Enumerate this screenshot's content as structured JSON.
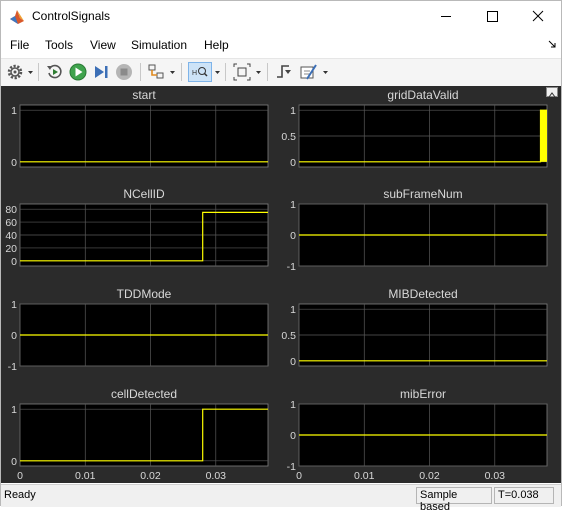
{
  "window": {
    "title": "ControlSignals",
    "minimize_label": "—",
    "maximize_label": "☐",
    "close_label": "✕"
  },
  "menu": {
    "items": [
      "File",
      "Tools",
      "View",
      "Simulation",
      "Help"
    ]
  },
  "toolbar": {
    "buttons": [
      "gear-icon",
      "play-back-icon",
      "run-icon",
      "step-forward-icon",
      "stop-icon",
      "highlight-icon",
      "zoom-icon",
      "fit-axes-icon",
      "triggers-icon",
      "measure-icon"
    ]
  },
  "status": {
    "left": "Ready",
    "mode": "Sample based",
    "time": "T=0.038"
  },
  "colors": {
    "plot_bg": "#000000",
    "figure_bg": "#2b2b2b",
    "signal": "#ffff00",
    "grid": "#5a5a5a",
    "text": "#d8d8d8"
  },
  "chart_data": [
    {
      "type": "line",
      "title": "start",
      "xlim": [
        0,
        0.038
      ],
      "ylim": [
        -0.1,
        1.1
      ],
      "yticks": [
        "0",
        "1"
      ],
      "ytick_values": [
        0,
        1
      ],
      "xticks": [
        "0",
        "0.01",
        "0.02",
        "0.03"
      ],
      "xtick_values": [
        0,
        0.01,
        0.02,
        0.03
      ],
      "show_xtick_labels": false,
      "series": [
        {
          "x": [
            0,
            0.038
          ],
          "y": [
            0,
            0
          ]
        }
      ]
    },
    {
      "type": "line",
      "title": "gridDataValid",
      "xlim": [
        0,
        0.038
      ],
      "ylim": [
        -0.1,
        1.1
      ],
      "yticks": [
        "0",
        "0.5",
        "1"
      ],
      "ytick_values": [
        0,
        0.5,
        1
      ],
      "xticks": [
        "0",
        "0.01",
        "0.02",
        "0.03"
      ],
      "xtick_values": [
        0,
        0.01,
        0.02,
        0.03
      ],
      "show_xtick_labels": false,
      "series": [
        {
          "x": [
            0,
            0.037,
            0.037,
            0.038
          ],
          "y": [
            0,
            0,
            1,
            1
          ]
        }
      ],
      "filled_region": {
        "x": [
          0.037,
          0.038
        ],
        "y": [
          0,
          1
        ]
      }
    },
    {
      "type": "line",
      "title": "NCellID",
      "xlim": [
        0,
        0.038
      ],
      "ylim": [
        -8,
        88
      ],
      "yticks": [
        "0",
        "20",
        "40",
        "60",
        "80"
      ],
      "ytick_values": [
        0,
        20,
        40,
        60,
        80
      ],
      "xticks": [
        "0",
        "0.01",
        "0.02",
        "0.03"
      ],
      "xtick_values": [
        0,
        0.01,
        0.02,
        0.03
      ],
      "show_xtick_labels": false,
      "series": [
        {
          "x": [
            0,
            0.028,
            0.028,
            0.038
          ],
          "y": [
            0,
            0,
            75,
            75
          ]
        }
      ]
    },
    {
      "type": "line",
      "title": "subFrameNum",
      "xlim": [
        0,
        0.038
      ],
      "ylim": [
        -1,
        1
      ],
      "yticks": [
        "-1",
        "0",
        "1"
      ],
      "ytick_values": [
        -1,
        0,
        1
      ],
      "xticks": [
        "0",
        "0.01",
        "0.02",
        "0.03"
      ],
      "xtick_values": [
        0,
        0.01,
        0.02,
        0.03
      ],
      "show_xtick_labels": false,
      "series": [
        {
          "x": [
            0,
            0.038
          ],
          "y": [
            0,
            0
          ]
        }
      ]
    },
    {
      "type": "line",
      "title": "TDDMode",
      "xlim": [
        0,
        0.038
      ],
      "ylim": [
        -1,
        1
      ],
      "yticks": [
        "-1",
        "0",
        "1"
      ],
      "ytick_values": [
        -1,
        0,
        1
      ],
      "xticks": [
        "0",
        "0.01",
        "0.02",
        "0.03"
      ],
      "xtick_values": [
        0,
        0.01,
        0.02,
        0.03
      ],
      "show_xtick_labels": false,
      "series": [
        {
          "x": [
            0,
            0.038
          ],
          "y": [
            0,
            0
          ]
        }
      ]
    },
    {
      "type": "line",
      "title": "MIBDetected",
      "xlim": [
        0,
        0.038
      ],
      "ylim": [
        -0.1,
        1.1
      ],
      "yticks": [
        "0",
        "0.5",
        "1"
      ],
      "ytick_values": [
        0,
        0.5,
        1
      ],
      "xticks": [
        "0",
        "0.01",
        "0.02",
        "0.03"
      ],
      "xtick_values": [
        0,
        0.01,
        0.02,
        0.03
      ],
      "show_xtick_labels": false,
      "series": [
        {
          "x": [
            0,
            0.038
          ],
          "y": [
            0,
            0
          ]
        }
      ]
    },
    {
      "type": "line",
      "title": "cellDetected",
      "xlim": [
        0,
        0.038
      ],
      "ylim": [
        -0.1,
        1.1
      ],
      "yticks": [
        "0",
        "1"
      ],
      "ytick_values": [
        0,
        1
      ],
      "xticks": [
        "0",
        "0.01",
        "0.02",
        "0.03"
      ],
      "xtick_values": [
        0,
        0.01,
        0.02,
        0.03
      ],
      "show_xtick_labels": true,
      "series": [
        {
          "x": [
            0,
            0.028,
            0.028,
            0.038
          ],
          "y": [
            0,
            0,
            1,
            1
          ]
        }
      ]
    },
    {
      "type": "line",
      "title": "mibError",
      "xlim": [
        0,
        0.038
      ],
      "ylim": [
        -1,
        1
      ],
      "yticks": [
        "-1",
        "0",
        "1"
      ],
      "ytick_values": [
        -1,
        0,
        1
      ],
      "xticks": [
        "0",
        "0.01",
        "0.02",
        "0.03"
      ],
      "xtick_values": [
        0,
        0.01,
        0.02,
        0.03
      ],
      "show_xtick_labels": true,
      "series": [
        {
          "x": [
            0,
            0.038
          ],
          "y": [
            0,
            0
          ]
        }
      ]
    }
  ]
}
